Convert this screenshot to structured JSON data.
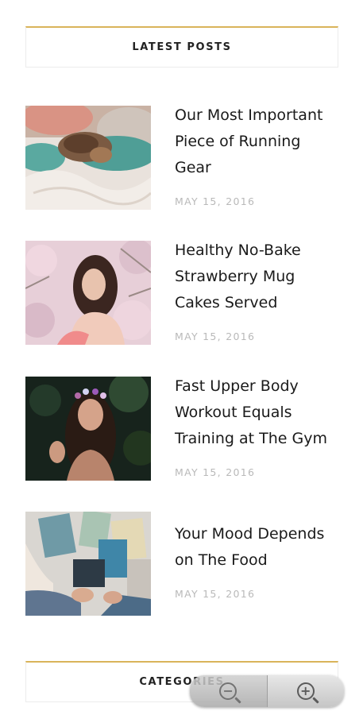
{
  "latest_posts": {
    "heading": "LATEST POSTS",
    "posts": [
      {
        "title": "Our Most Important Piece of Running Gear",
        "date": "MAY 15, 2016",
        "image": "cat-on-bed-photo"
      },
      {
        "title": "Healthy No-Bake Strawberry Mug Cakes Served",
        "date": "MAY 15, 2016",
        "image": "woman-blossom-photo"
      },
      {
        "title": "Fast Upper Body Workout Equals Training at The Gym",
        "date": "MAY 15, 2016",
        "image": "woman-flower-crown-photo"
      },
      {
        "title": "Your Mood Depends on The Food",
        "date": "MAY 15, 2016",
        "image": "magazines-photo"
      }
    ]
  },
  "categories": {
    "heading": "CATEGORIES"
  },
  "zoom": {
    "out_symbol": "−",
    "in_symbol": "+"
  },
  "colors": {
    "accent": "#d9b45a",
    "date": "#b9b9b9"
  }
}
